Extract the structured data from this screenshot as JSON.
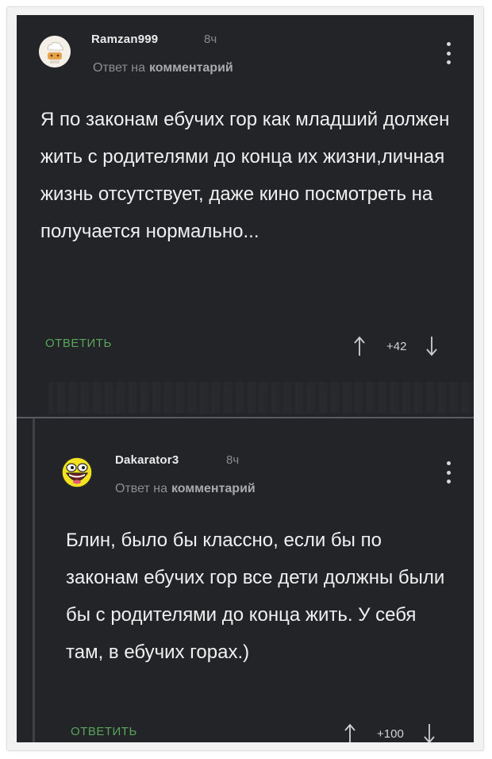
{
  "comments": [
    {
      "username": "Ramzan999",
      "time": "8ч",
      "reply_prefix": "Ответ на",
      "reply_link": "комментарий",
      "text": "Я по законам ебучих гор как младший должен жить с родителями до конца их жизни,личная жизнь отсутствует, даже кино посмотреть на получается нормально...",
      "reply_label": "ОТВЕТИТЬ",
      "score": "+42",
      "avatar_icon": "chef-cook-avatar-icon"
    },
    {
      "username": "Dakarator3",
      "time": "8ч",
      "reply_prefix": "Ответ на",
      "reply_link": "комментарий",
      "text": "Блин, было бы классно, если бы по законам ебучих гор все дети должны были бы с родителями до конца жить. У себя там, в ебучих горах.)",
      "reply_label": "ОТВЕТИТЬ",
      "score": "+100",
      "avatar_icon": "awesome-face-avatar-icon"
    }
  ],
  "colors": {
    "background": "#232427",
    "accent_green": "#58a65c",
    "text": "#f0f0f0",
    "muted": "#8d8e92"
  }
}
